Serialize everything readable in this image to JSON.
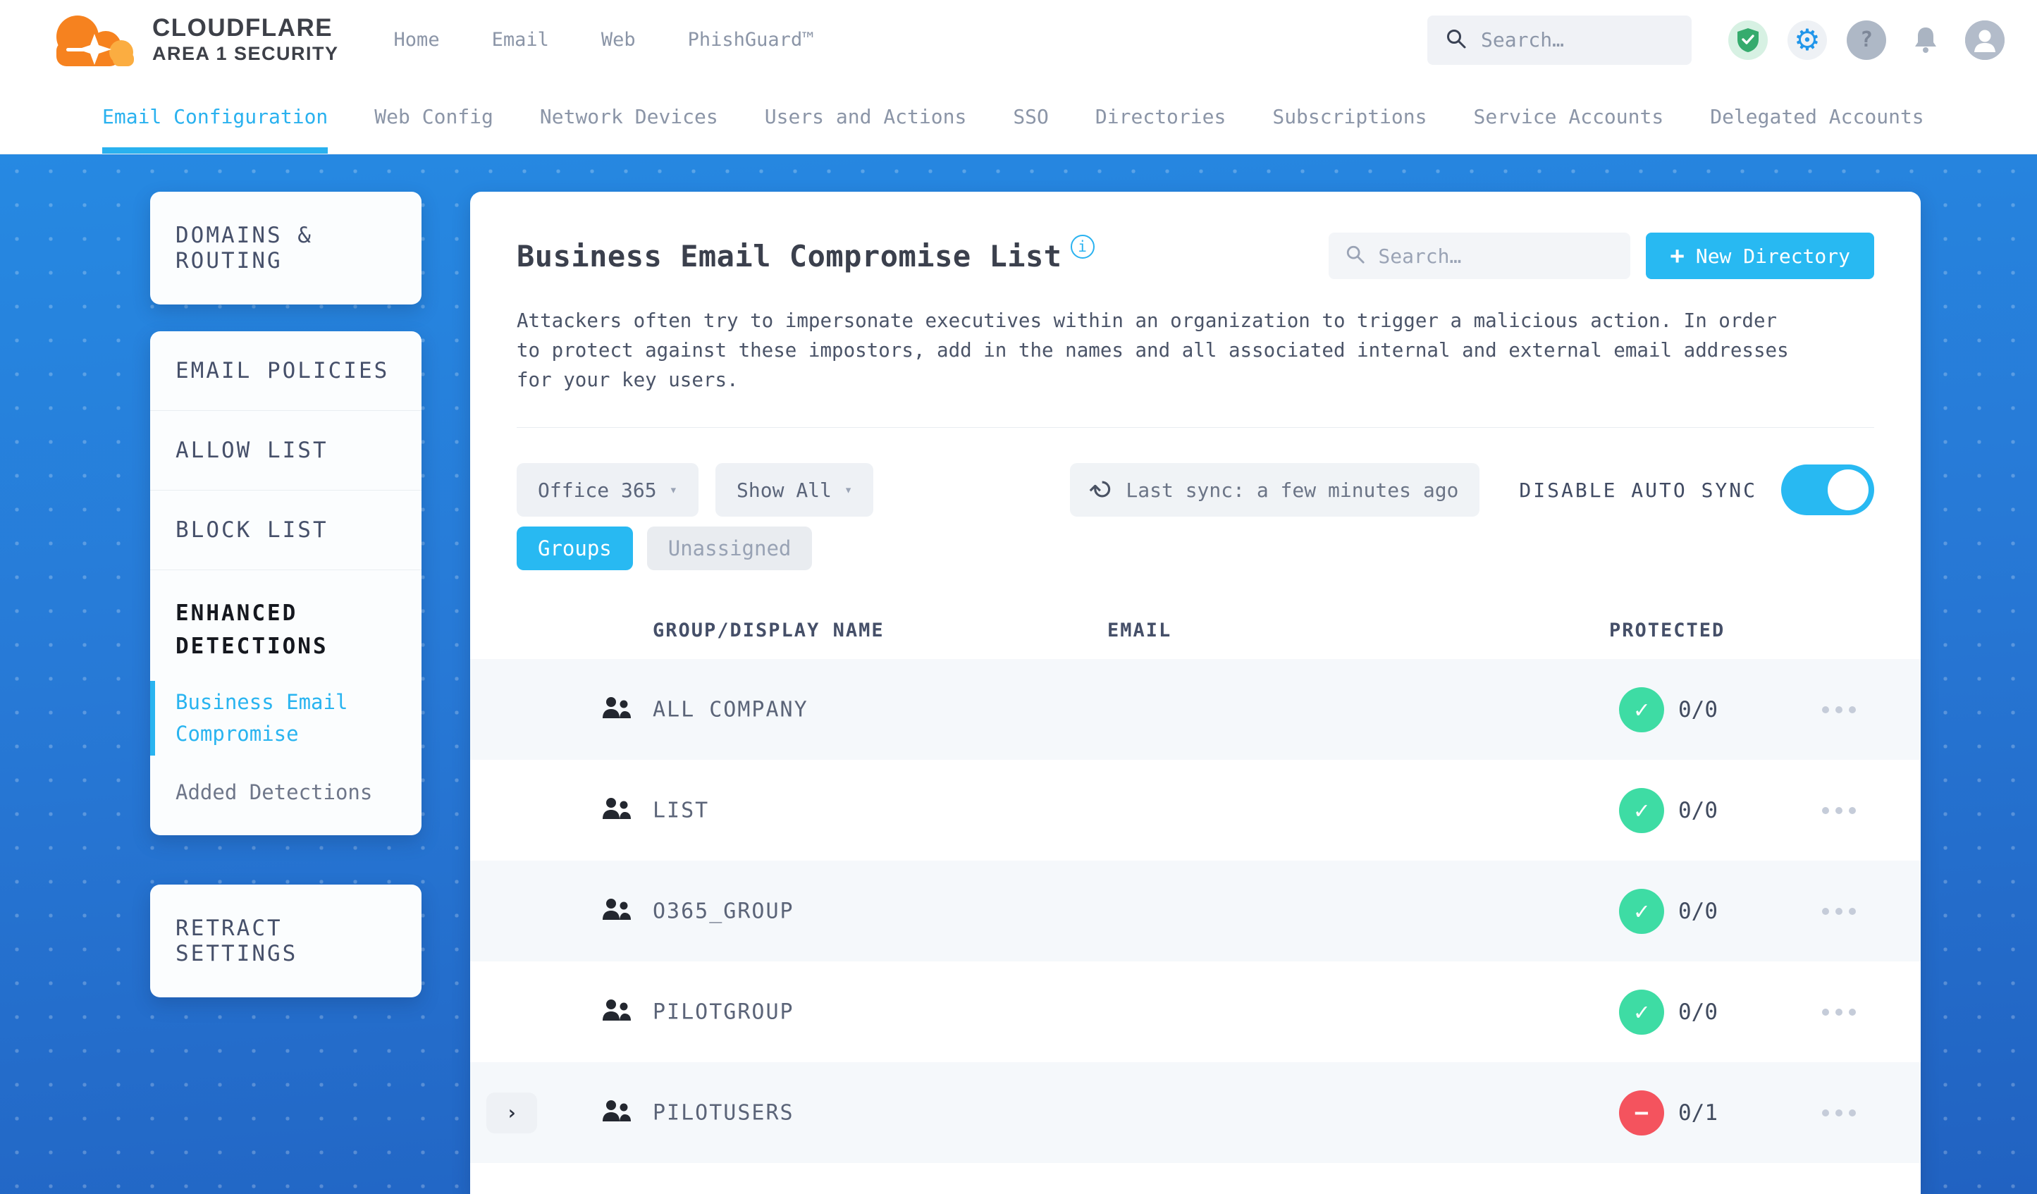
{
  "header": {
    "brand_line1": "CLOUDFLARE",
    "brand_line2": "AREA 1 SECURITY",
    "nav": {
      "home": "Home",
      "email": "Email",
      "web": "Web",
      "phishguard": "PhishGuard™"
    },
    "search_placeholder": "Search…"
  },
  "nav_tabs": {
    "email_configuration": "Email Configuration",
    "web_config": "Web Config",
    "network_devices": "Network Devices",
    "users_and_actions": "Users and Actions",
    "sso": "SSO",
    "directories": "Directories",
    "subscriptions": "Subscriptions",
    "service_accounts": "Service Accounts",
    "delegated_accounts": "Delegated Accounts"
  },
  "sidebar": {
    "domains_routing": "DOMAINS & ROUTING",
    "email_policies": "EMAIL POLICIES",
    "allow_list": "ALLOW LIST",
    "block_list": "BLOCK LIST",
    "enhanced_detections": "ENHANCED DETECTIONS",
    "business_email_compromise": "Business Email Compromise",
    "added_detections": "Added Detections",
    "retract_settings": "RETRACT SETTINGS"
  },
  "main": {
    "title": "Business Email Compromise List",
    "info_glyph": "i",
    "search_placeholder": "Search…",
    "new_directory_plus": "+",
    "new_directory_label": "New Directory",
    "description": "Attackers often try to impersonate executives within an organization to trigger a malicious action. In order to protect against these impostors, add in the names and all associated internal and external email addresses for your key users.",
    "filters": {
      "directory_select": "Office 365",
      "show_select": "Show All",
      "last_sync": "Last sync: a few minutes ago",
      "auto_sync_label": "DISABLE AUTO SYNC",
      "auto_sync_on": true
    },
    "tabs": {
      "groups": "Groups",
      "unassigned": "Unassigned"
    },
    "table": {
      "columns": {
        "name": "GROUP/DISPLAY NAME",
        "email": "EMAIL",
        "protected": "PROTECTED"
      },
      "rows": [
        {
          "name": "ALL COMPANY",
          "email": "",
          "protected_count": "0/0",
          "status": "ok"
        },
        {
          "name": "LIST",
          "email": "",
          "protected_count": "0/0",
          "status": "ok"
        },
        {
          "name": "O365_GROUP",
          "email": "",
          "protected_count": "0/0",
          "status": "ok"
        },
        {
          "name": "PILOTGROUP",
          "email": "",
          "protected_count": "0/0",
          "status": "ok"
        },
        {
          "name": "PILOTUSERS",
          "email": "",
          "protected_count": "0/1",
          "status": "blocked"
        }
      ]
    }
  },
  "colors": {
    "accent_cyan": "#28b9f2",
    "background_blue_top": "#2689e2",
    "background_blue_bottom": "#2162c1",
    "protected_green": "#3edca4",
    "blocked_red": "#f4535e"
  }
}
